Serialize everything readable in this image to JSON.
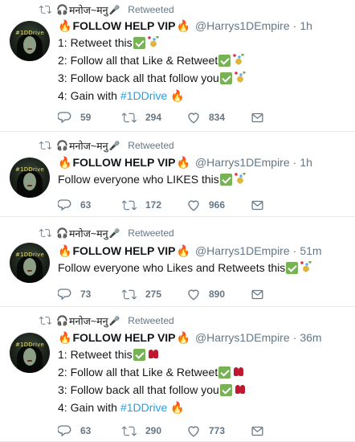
{
  "retweeter": {
    "name": "मनोज~मनु",
    "headphones_icon": "headphones-icon",
    "mic_icon": "microphone-icon",
    "label": "Retweeted"
  },
  "colors": {
    "muted": "#657786",
    "link": "#1da1f2",
    "check": "#77b255",
    "divider": "#e6ecf0"
  },
  "tweets": [
    {
      "avatar_text": "#1DDrive",
      "title": "FOLLOW HELP VIP",
      "handle": "@Harrys1DEmpire",
      "time": "1h",
      "lines": [
        {
          "text": "1: Retweet this",
          "emoji": [
            "check",
            "confetti"
          ]
        },
        {
          "text": "2: Follow all that Like & Retweet",
          "emoji": [
            "check",
            "confetti"
          ]
        },
        {
          "text": "3: Follow back all that follow you",
          "emoji": [
            "check",
            "confetti"
          ]
        },
        {
          "text": "4: Gain with",
          "link": "#1DDrive",
          "emoji": [
            "fire"
          ]
        }
      ],
      "replies": "59",
      "retweets": "294",
      "likes": "834"
    },
    {
      "avatar_text": "#1DDrive",
      "title": "FOLLOW HELP VIP",
      "handle": "@Harrys1DEmpire",
      "time": "1h",
      "lines": [
        {
          "text": "Follow everyone who LIKES this",
          "emoji": [
            "check",
            "confetti"
          ]
        }
      ],
      "replies": "63",
      "retweets": "172",
      "likes": "966"
    },
    {
      "avatar_text": "#1DDrive",
      "title": "FOLLOW HELP VIP",
      "handle": "@Harrys1DEmpire",
      "time": "51m",
      "lines": [
        {
          "text": "Follow everyone who Likes and Retweets this",
          "emoji": [
            "check",
            "confetti"
          ]
        }
      ],
      "replies": "73",
      "retweets": "275",
      "likes": "890"
    },
    {
      "avatar_text": "#1DDrive",
      "title": "FOLLOW HELP VIP",
      "handle": "@Harrys1DEmpire",
      "time": "36m",
      "lines": [
        {
          "text": "1: Retweet this",
          "emoji": [
            "check",
            "mitt"
          ]
        },
        {
          "text": "2: Follow all that Like & Retweet",
          "emoji": [
            "check",
            "mitt"
          ]
        },
        {
          "text": "3: Follow back all that follow you",
          "emoji": [
            "check",
            "mitt"
          ]
        },
        {
          "text": "4: Gain with",
          "link": "#1DDrive",
          "emoji": [
            "fire"
          ]
        }
      ],
      "replies": "63",
      "retweets": "290",
      "likes": "773"
    }
  ]
}
